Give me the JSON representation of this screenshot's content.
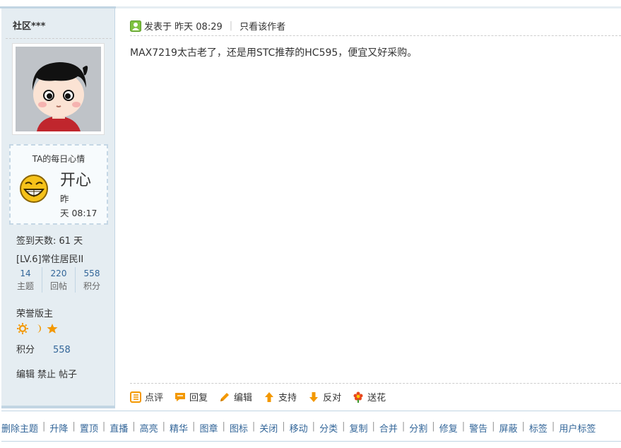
{
  "user": {
    "name": "社区***",
    "mood": {
      "title": "TA的每日心情",
      "word": "开心",
      "time_line1": "昨",
      "time_line2": "天 08:17"
    },
    "checkin": "签到天数: 61 天",
    "level": "[LV.6]常住居民II",
    "counts": [
      {
        "num": "14",
        "label": "主题"
      },
      {
        "num": "220",
        "label": "回帖"
      },
      {
        "num": "558",
        "label": "积分"
      }
    ],
    "rank_title": "荣誉版主",
    "points_label": "积分",
    "points_value": "558",
    "admin_links": [
      "编辑",
      "禁止",
      "帖子"
    ]
  },
  "post": {
    "posted_label": "发表于",
    "posted_time": "昨天 08:29",
    "author_only": "只看该作者",
    "body": "MAX7219太古老了，还是用STC推荐的HC595，便宜又好采购。"
  },
  "actions": [
    {
      "icon": "comment-icon",
      "label": "点评"
    },
    {
      "icon": "reply-icon",
      "label": "回复"
    },
    {
      "icon": "edit-icon",
      "label": "编辑"
    },
    {
      "icon": "thumbs-up-arrow-icon",
      "label": "支持"
    },
    {
      "icon": "thumbs-down-arrow-icon",
      "label": "反对"
    },
    {
      "icon": "flower-icon",
      "label": "送花"
    }
  ],
  "mod_actions": [
    "删除主题",
    "升降",
    "置顶",
    "直播",
    "高亮",
    "精华",
    "图章",
    "图标",
    "关闭",
    "移动",
    "分类",
    "复制",
    "合并",
    "分割",
    "修复",
    "警告",
    "屏蔽",
    "标签",
    "用户标签"
  ],
  "colors": {
    "sidebar_bg": "#e5edf2",
    "border": "#c2d5e3",
    "link": "#336699",
    "accent_orange": "#f39800"
  }
}
